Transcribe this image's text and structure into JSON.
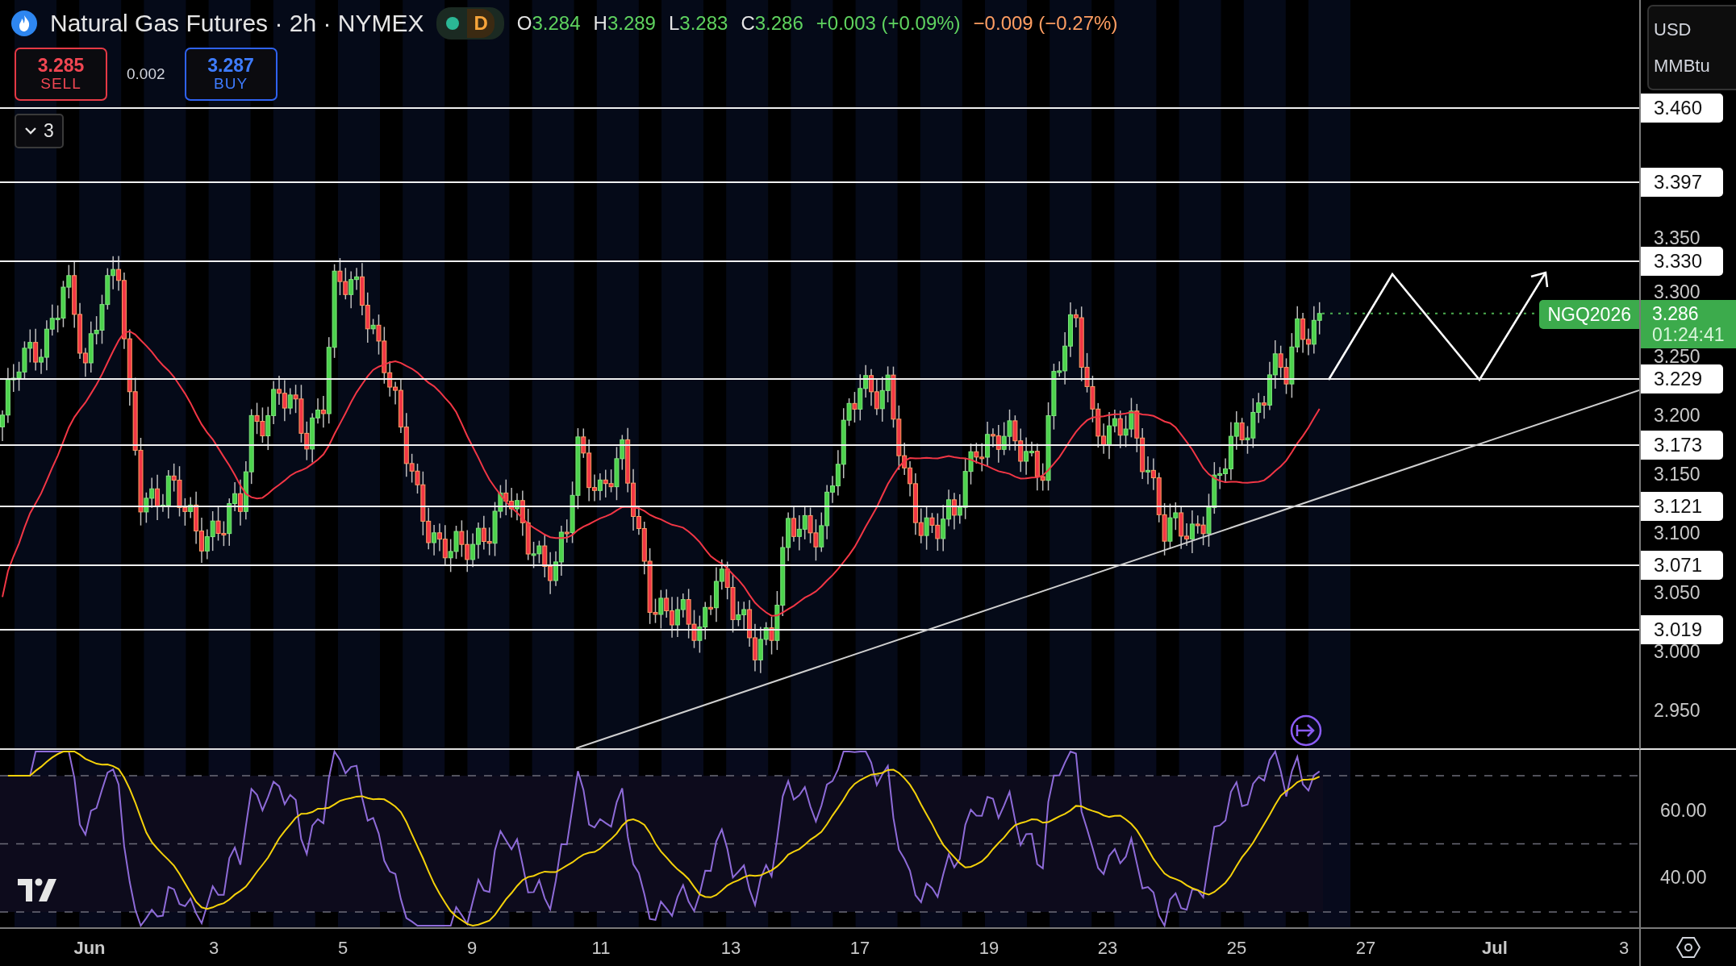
{
  "header": {
    "title": "Natural Gas Futures · 2h · NYMEX",
    "market_status": "D",
    "ohlc": [
      {
        "label": "O",
        "value": "3.284"
      },
      {
        "label": "H",
        "value": "3.289"
      },
      {
        "label": "L",
        "value": "3.283"
      },
      {
        "label": "C",
        "value": "3.286"
      }
    ],
    "change": "+0.003 (+0.09%)",
    "change_extended": "−0.009 (−0.27%)"
  },
  "trade": {
    "sell": {
      "price": "3.285",
      "label": "SELL"
    },
    "spread": "0.002",
    "buy": {
      "price": "3.287",
      "label": "BUY"
    }
  },
  "indicators_toggle": {
    "count": "3",
    "expanded": false
  },
  "currency_menu": [
    "USD",
    "MMBtu"
  ],
  "price_axis": {
    "ticks": [
      "3.350",
      "3.300",
      "3.250",
      "3.200",
      "3.150",
      "3.100",
      "3.050",
      "3.000",
      "2.950"
    ]
  },
  "levels": [
    "3.460",
    "3.397",
    "3.330",
    "3.229",
    "3.173",
    "3.121",
    "3.071",
    "3.019"
  ],
  "last_price": {
    "symbol": "NGQ2026",
    "price": "3.286",
    "countdown": "01:24:41"
  },
  "rsi_axis": {
    "ticks": [
      "60.00",
      "40.00"
    ]
  },
  "time_axis": [
    {
      "label": "Jun",
      "kind": "month"
    },
    {
      "label": "3",
      "kind": "day"
    },
    {
      "label": "5",
      "kind": "day"
    },
    {
      "label": "9",
      "kind": "day"
    },
    {
      "label": "11",
      "kind": "day"
    },
    {
      "label": "13",
      "kind": "day"
    },
    {
      "label": "17",
      "kind": "day"
    },
    {
      "label": "19",
      "kind": "day"
    },
    {
      "label": "23",
      "kind": "day"
    },
    {
      "label": "25",
      "kind": "day"
    },
    {
      "label": "27",
      "kind": "day"
    },
    {
      "label": "Jul",
      "kind": "month"
    },
    {
      "label": "3",
      "kind": "day"
    }
  ]
}
